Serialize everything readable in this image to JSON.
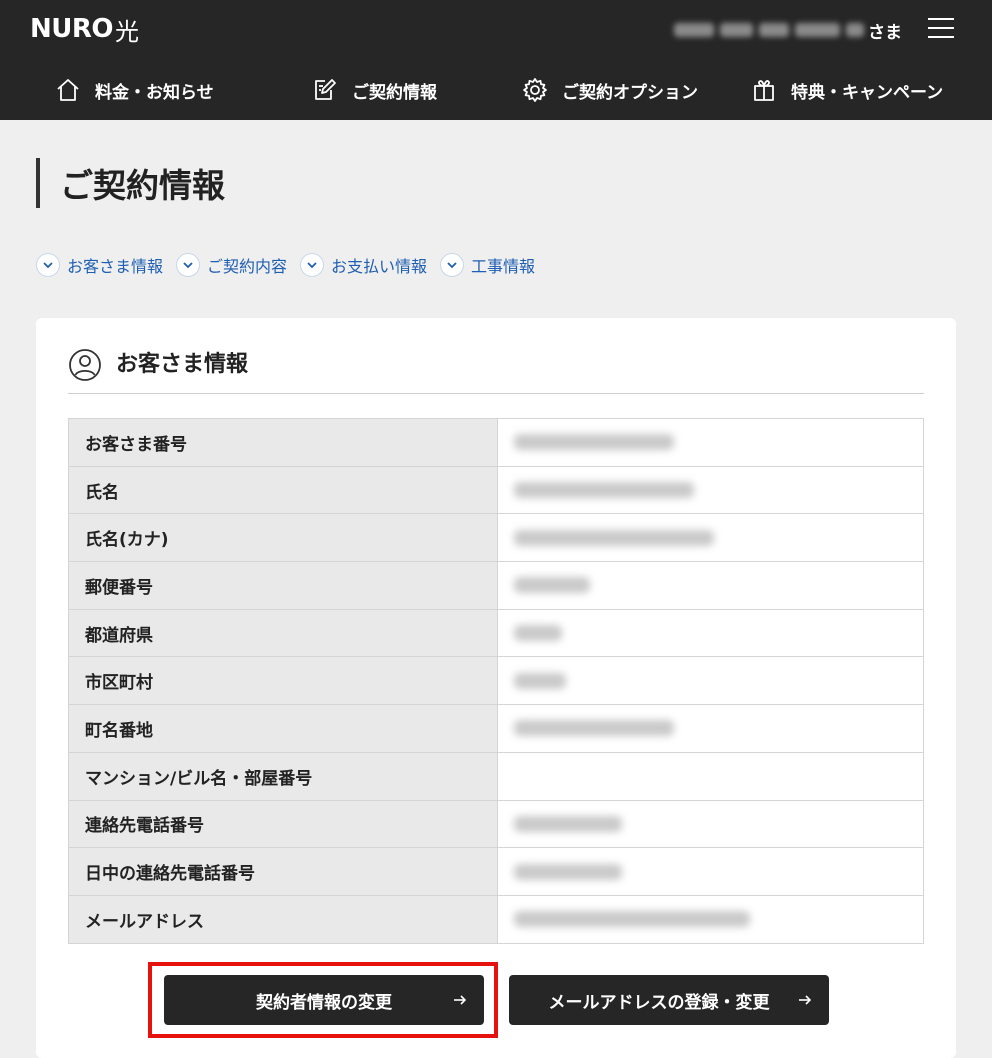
{
  "header": {
    "logo_main": "NURO",
    "logo_sub": "光",
    "user_suffix": "さま"
  },
  "nav": {
    "items": [
      {
        "label": "料金・お知らせ",
        "icon": "home-icon"
      },
      {
        "label": "ご契約情報",
        "icon": "edit-icon"
      },
      {
        "label": "ご契約オプション",
        "icon": "gear-icon"
      },
      {
        "label": "特典・キャンペーン",
        "icon": "gift-icon"
      }
    ]
  },
  "page": {
    "title": "ご契約情報"
  },
  "anchors": [
    {
      "label": "お客さま情報"
    },
    {
      "label": "ご契約内容"
    },
    {
      "label": "お支払い情報"
    },
    {
      "label": "工事情報"
    }
  ],
  "customer_section": {
    "title": "お客さま情報",
    "rows": [
      {
        "label": "お客さま番号"
      },
      {
        "label": "氏名"
      },
      {
        "label": "氏名(カナ)"
      },
      {
        "label": "郵便番号"
      },
      {
        "label": "都道府県"
      },
      {
        "label": "市区町村"
      },
      {
        "label": "町名番地"
      },
      {
        "label": "マンション/ビル名・部屋番号"
      },
      {
        "label": "連絡先電話番号"
      },
      {
        "label": "日中の連絡先電話番号"
      },
      {
        "label": "メールアドレス"
      }
    ],
    "buttons": {
      "change_contract": "契約者情報の変更",
      "change_email": "メールアドレスの登録・変更"
    }
  },
  "colors": {
    "header_bg": "#262626",
    "page_bg": "#efefef",
    "link": "#1f5fb3",
    "highlight": "#e5120d"
  }
}
